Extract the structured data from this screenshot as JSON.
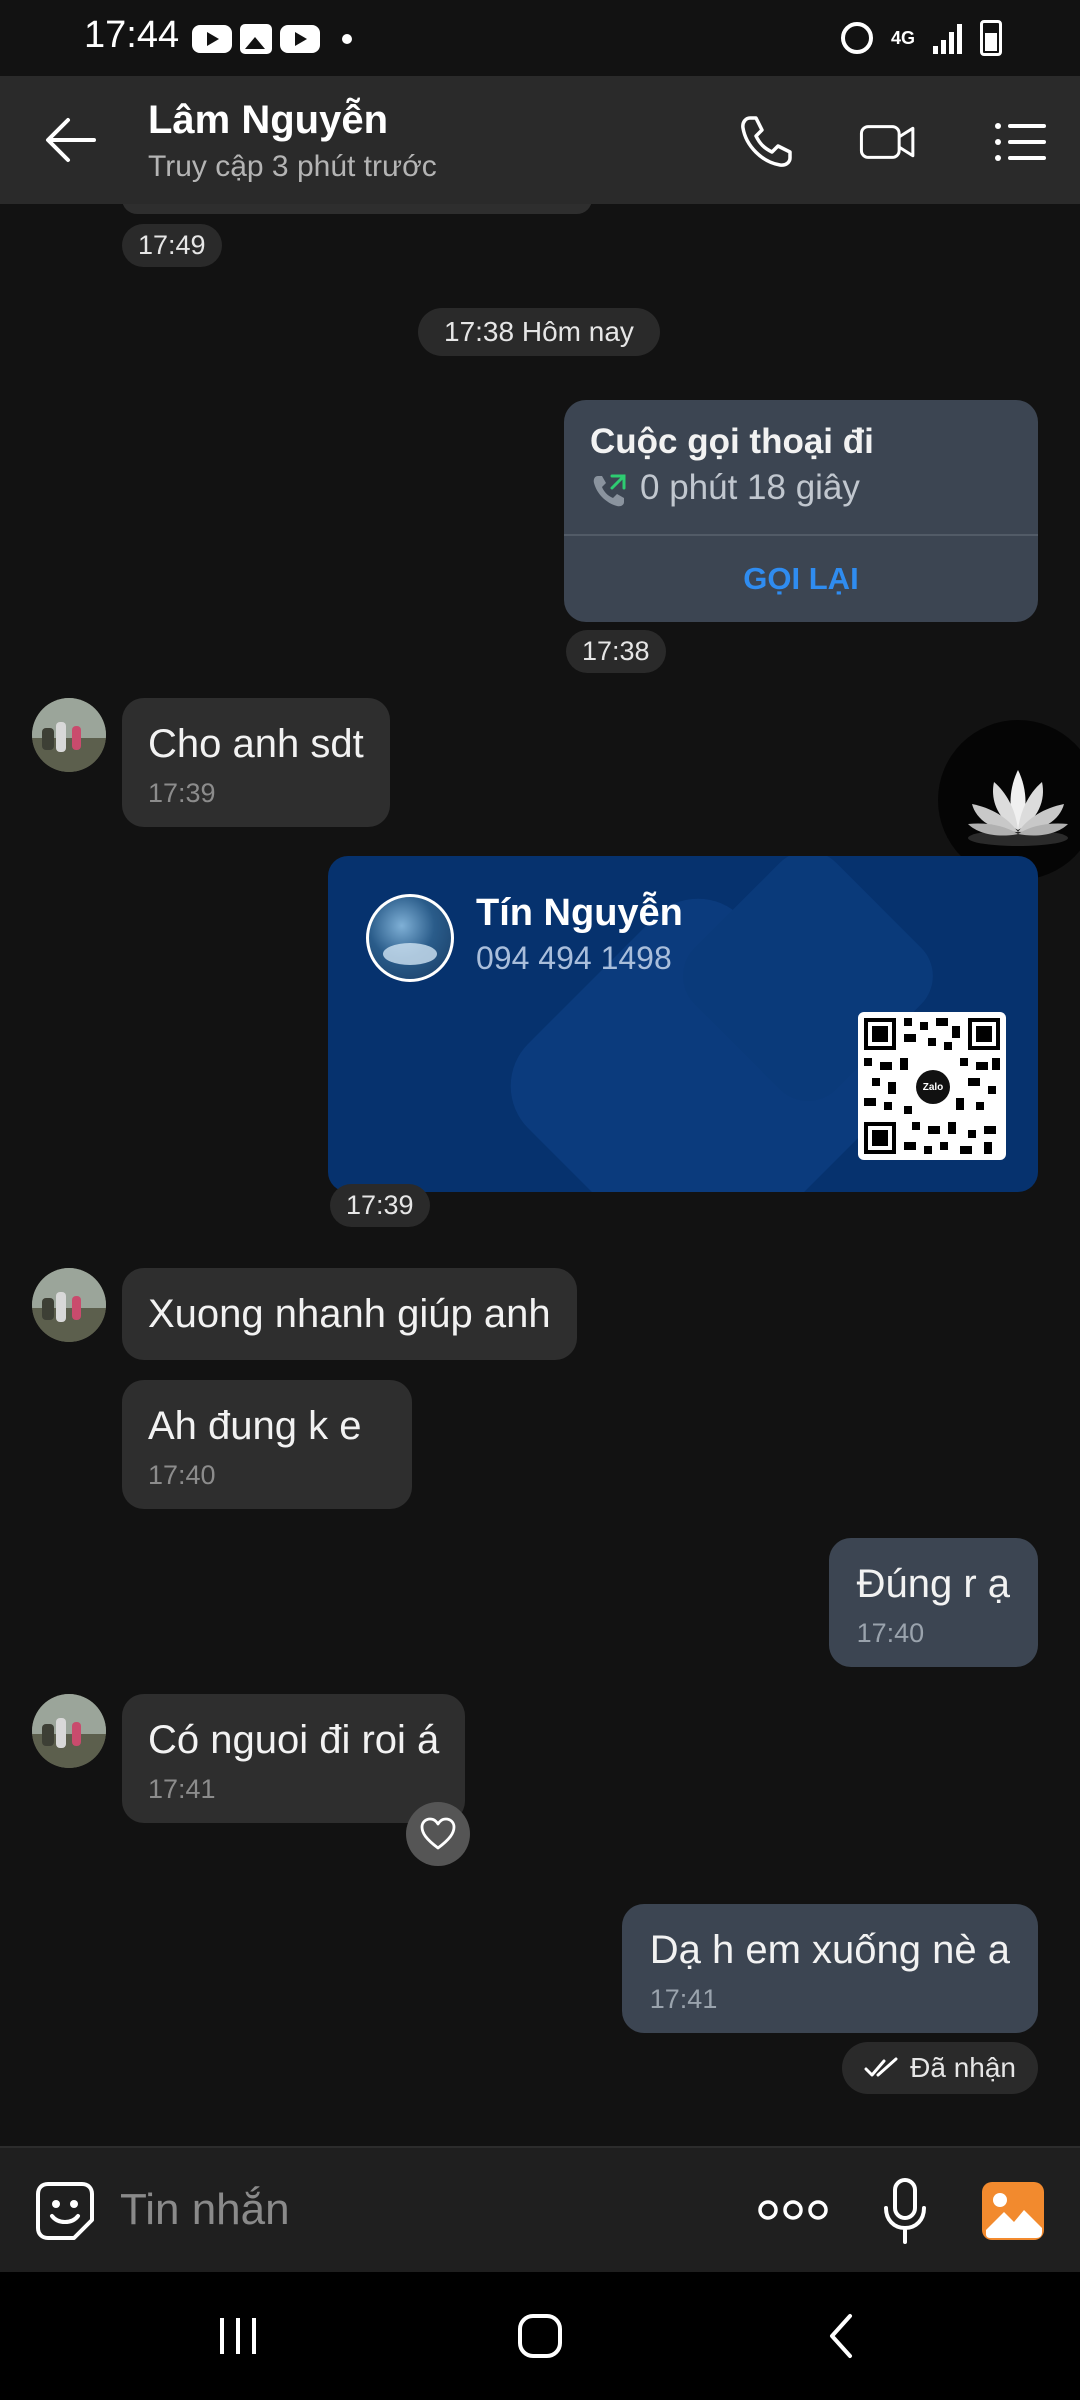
{
  "status_bar": {
    "time": "17:44",
    "network": "4G"
  },
  "header": {
    "contact_name": "Lâm Nguyễn",
    "contact_status": "Truy cập 3 phút trước"
  },
  "chat": {
    "prev_time": "17:49",
    "date_separator": "17:38 Hôm nay",
    "call_card": {
      "title": "Cuộc gọi thoại đi",
      "duration": "0 phút 18 giây",
      "action": "GỌI LẠI",
      "time": "17:38"
    },
    "msg1": {
      "text": "Cho anh sdt",
      "time": "17:39"
    },
    "contact_card": {
      "name": "Tín Nguyễn",
      "phone": "094 494 1498",
      "qr_logo": "Zalo",
      "time": "17:39"
    },
    "msg2": {
      "text": "Xuong nhanh giúp anh"
    },
    "msg3": {
      "text": "Ah đung k e",
      "time": "17:40"
    },
    "msg4": {
      "text": "Đúng r ạ",
      "time": "17:40"
    },
    "msg5": {
      "text": "Có nguoi đi roi á",
      "time": "17:41"
    },
    "msg6": {
      "text": "Dạ h em xuống nè a",
      "time": "17:41"
    },
    "received_status": "Đã nhận"
  },
  "input_bar": {
    "placeholder": "Tin nhắn"
  },
  "colors": {
    "accent_blue": "#2f8cf0",
    "outgoing_bubble": "#3c4552",
    "incoming_bubble": "#2e2e2e",
    "contact_card_bg": "#06326e",
    "image_icon": "#f28a2e",
    "call_icon_green": "#2ecc71"
  }
}
